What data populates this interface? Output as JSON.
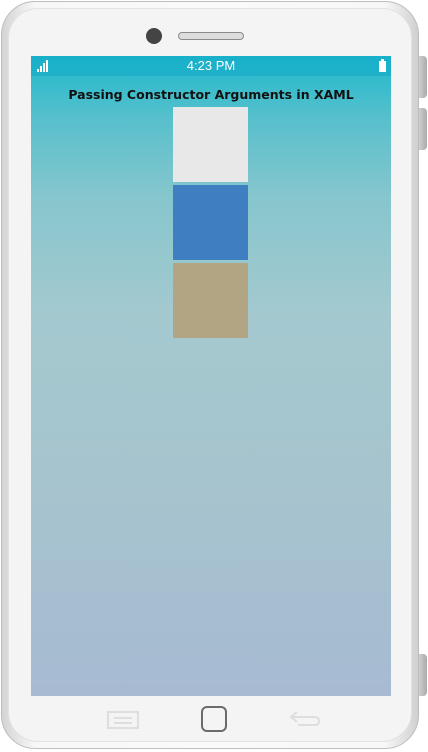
{
  "status_bar": {
    "time": "4:23 PM",
    "signal_icon": "signal-bars-icon",
    "battery_icon": "battery-icon"
  },
  "page": {
    "title": "Passing Constructor Arguments in XAML"
  },
  "color_boxes": [
    {
      "name": "box-light-gray",
      "color": "#e8e8e8"
    },
    {
      "name": "box-blue",
      "color": "#3f7fc1"
    },
    {
      "name": "box-tan",
      "color": "#b2a584"
    }
  ],
  "nav_bar": {
    "menu_icon": "menu-icon",
    "home_icon": "home-icon",
    "back_icon": "back-icon"
  }
}
